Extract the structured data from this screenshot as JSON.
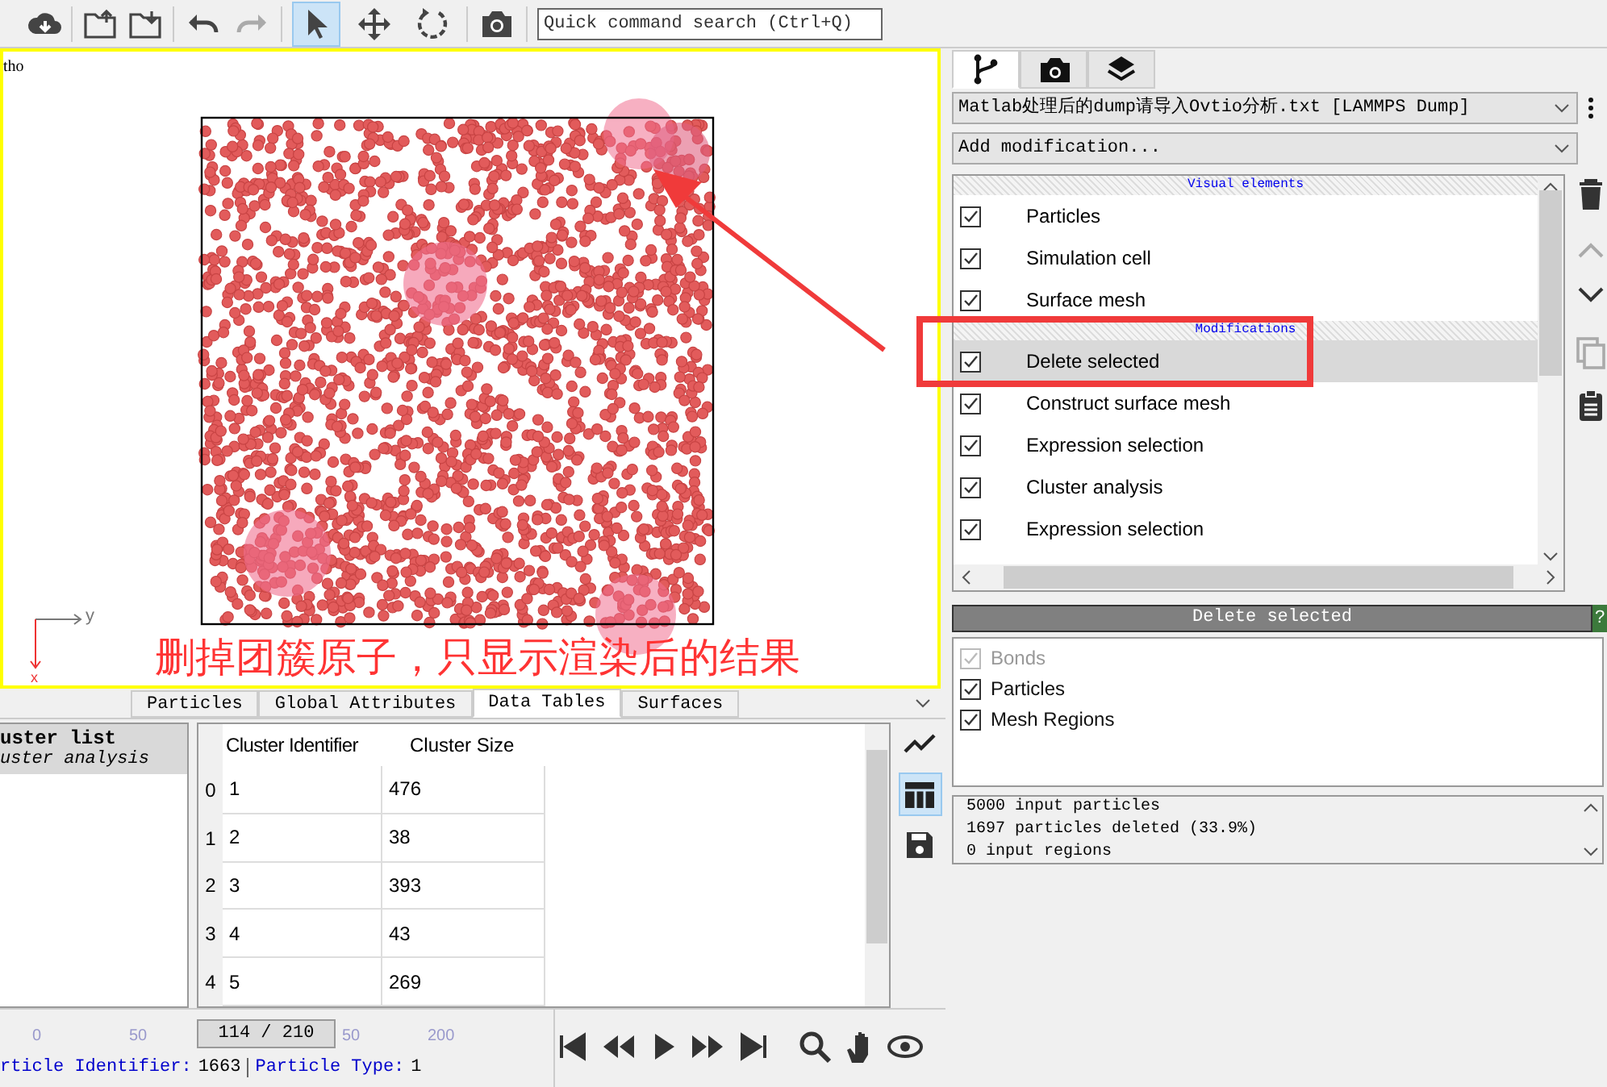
{
  "toolbar": {
    "mode_tools": [
      {
        "selected": true
      },
      {
        "selected": false
      },
      {
        "selected": false
      }
    ],
    "search": {
      "placeholder": "Quick command search (Ctrl+Q)"
    }
  },
  "viewport": {
    "caption": "tho",
    "axis_labels": [
      "y",
      "x"
    ],
    "annotation": "删掉团簇原子，只显示渲染后的结果"
  },
  "command_panel": {
    "tabs": [
      {
        "selected": true
      },
      {
        "selected": false
      },
      {
        "selected": false
      }
    ],
    "pipeline_source": "Matlab处理后的dump请导入Ovtio分析.txt [LAMMPS Dump]",
    "add_modification": "Add modification...",
    "pipeline": [
      {
        "heading": "Visual elements",
        "items": [
          {
            "label": "Particles",
            "checked": true,
            "selected": false
          },
          {
            "label": "Simulation cell",
            "checked": true,
            "selected": false
          },
          {
            "label": "Surface mesh",
            "checked": true,
            "selected": false
          }
        ]
      },
      {
        "heading": "Modifications",
        "items": [
          {
            "label": "Delete selected",
            "checked": true,
            "selected": true
          },
          {
            "label": "Construct surface mesh",
            "checked": true,
            "selected": false
          },
          {
            "label": "Expression selection",
            "checked": true,
            "selected": false
          },
          {
            "label": "Cluster analysis",
            "checked": true,
            "selected": false
          },
          {
            "label": "Expression selection",
            "checked": true,
            "selected": false
          }
        ]
      }
    ],
    "editor": {
      "title": "Delete selected",
      "help": "?",
      "options": [
        {
          "label": "Bonds",
          "checked": true,
          "disabled": true
        },
        {
          "label": "Particles",
          "checked": true,
          "disabled": false
        },
        {
          "label": "Mesh Regions",
          "checked": true,
          "disabled": false
        }
      ],
      "status_lines": [
        "5000 input particles",
        "1697 particles deleted (33.9%)",
        "0 input regions"
      ]
    }
  },
  "data_inspector": {
    "tabs": [
      {
        "label": "Particles",
        "selected": false
      },
      {
        "label": "Global Attributes",
        "selected": false
      },
      {
        "label": "Data Tables",
        "selected": true
      },
      {
        "label": "Surfaces",
        "selected": false
      }
    ],
    "table_list": [
      {
        "title": "uster list",
        "subtitle": "uster analysis",
        "selected": true
      }
    ],
    "table": {
      "columns": [
        "",
        "Cluster Identifier",
        "Cluster Size"
      ],
      "rows": [
        [
          "0",
          "1",
          "476"
        ],
        [
          "1",
          "2",
          "38"
        ],
        [
          "2",
          "3",
          "393"
        ],
        [
          "3",
          "4",
          "43"
        ],
        [
          "4",
          "5",
          "269"
        ]
      ]
    },
    "side_tools": [
      {
        "selected": false
      },
      {
        "selected": true
      },
      {
        "selected": false
      }
    ]
  },
  "timeline": {
    "ticks": [
      "0",
      "50",
      "50",
      "200"
    ],
    "slider": "114 / 210"
  },
  "status_bar": {
    "label_1": "rticle Identifier:",
    "value_1": "1663",
    "label_2": "Particle Type:",
    "value_2": "1"
  }
}
